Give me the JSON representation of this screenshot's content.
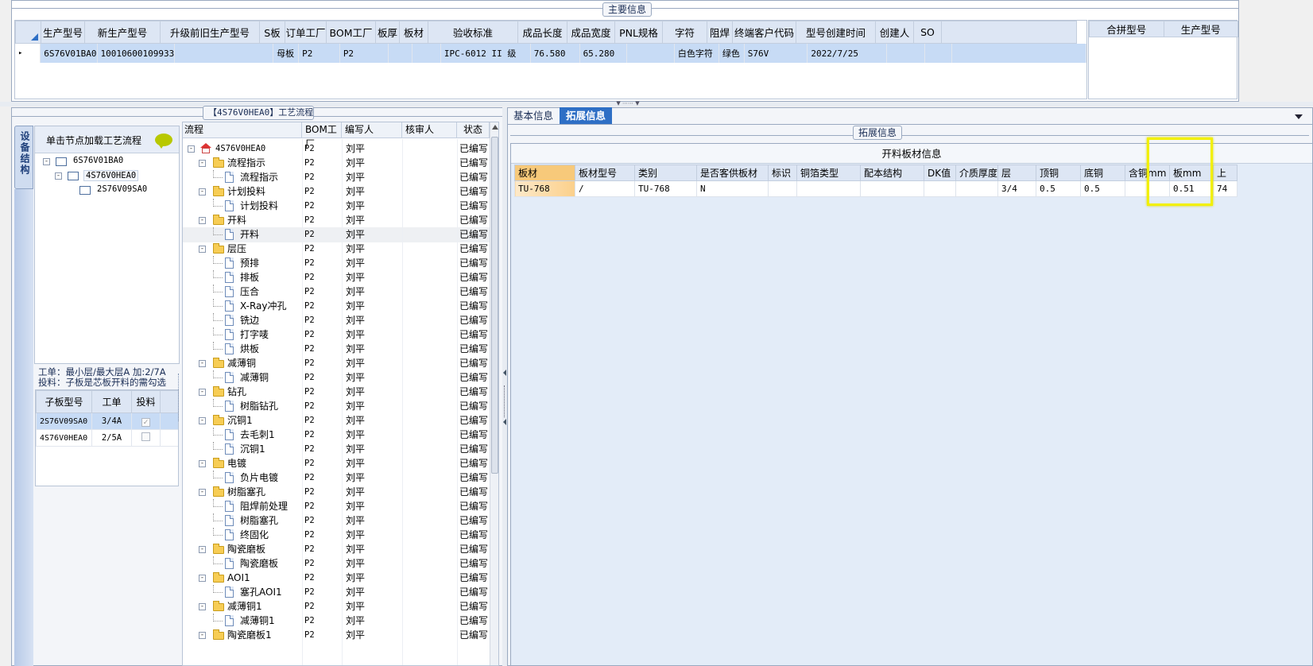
{
  "main_info": {
    "caption": "主要信息",
    "columns": [
      "生产型号",
      "新生产型号",
      "升级前旧生产型号",
      "S板",
      "订单工厂",
      "BOM工厂",
      "板厚",
      "板材",
      "验收标准",
      "成品长度",
      "成品宽度",
      "PNL规格",
      "字符",
      "阻焊",
      "终端客户代码",
      "型号创建时间",
      "创建人",
      "SO"
    ],
    "row": [
      "6S76V01BA0",
      "10010600109933",
      "",
      "母板",
      "P2",
      "P2",
      "",
      "",
      "IPC-6012 II 级",
      "76.580",
      "65.280",
      "",
      "白色字符",
      "绿色",
      "S76V",
      "2022/7/25",
      "",
      ""
    ],
    "row_marker": "▸",
    "side_columns": [
      "合拼型号",
      "生产型号"
    ]
  },
  "process": {
    "caption": "【4S76V0HEA0】工艺流程",
    "vertical_tab": "设备结构",
    "load_hint": "单击节点加载工艺流程",
    "structure_tree": [
      "6S76V01BA0",
      "4S76V0HEA0",
      "2S76V09SA0"
    ],
    "note_line1": "工单：最小层/最大层A 加:2/7A",
    "note_line2": "投料：子板是芯板开料的需勾选",
    "sub_columns": [
      "子板型号",
      "工单",
      "投料"
    ],
    "sub_rows": [
      {
        "model": "2S76V09SA0",
        "order": "3/4A",
        "checked": true
      },
      {
        "model": "4S76V0HEA0",
        "order": "2/5A",
        "checked": false
      }
    ],
    "flow_columns": [
      "流程",
      "BOM工厂",
      "编写人",
      "核审人",
      "状态"
    ],
    "root": "4S76V0HEA0",
    "factory": "P2",
    "writer": "刘平",
    "status": "已编写",
    "flow_rows": [
      {
        "level": 1,
        "name": "流程指示"
      },
      {
        "level": 2,
        "name": "流程指示"
      },
      {
        "level": 1,
        "name": "计划投料"
      },
      {
        "level": 2,
        "name": "计划投料"
      },
      {
        "level": 1,
        "name": "开料"
      },
      {
        "level": 2,
        "name": "开料"
      },
      {
        "level": 1,
        "name": "层压"
      },
      {
        "level": 2,
        "name": "预排"
      },
      {
        "level": 2,
        "name": "排板"
      },
      {
        "level": 2,
        "name": "压合"
      },
      {
        "level": 2,
        "name": "X-Ray冲孔"
      },
      {
        "level": 2,
        "name": "铣边"
      },
      {
        "level": 2,
        "name": "打字唛"
      },
      {
        "level": 2,
        "name": "烘板"
      },
      {
        "level": 1,
        "name": "减薄铜"
      },
      {
        "level": 2,
        "name": "减薄铜"
      },
      {
        "level": 1,
        "name": "钻孔"
      },
      {
        "level": 2,
        "name": "树脂钻孔"
      },
      {
        "level": 1,
        "name": "沉铜1"
      },
      {
        "level": 2,
        "name": "去毛刺1"
      },
      {
        "level": 2,
        "name": "沉铜1"
      },
      {
        "level": 1,
        "name": "电镀"
      },
      {
        "level": 2,
        "name": "负片电镀"
      },
      {
        "level": 1,
        "name": "树脂塞孔"
      },
      {
        "level": 2,
        "name": "阻焊前处理"
      },
      {
        "level": 2,
        "name": "树脂塞孔"
      },
      {
        "level": 2,
        "name": "终固化"
      },
      {
        "level": 1,
        "name": "陶瓷磨板"
      },
      {
        "level": 2,
        "name": "陶瓷磨板"
      },
      {
        "level": 1,
        "name": "AOI1"
      },
      {
        "level": 2,
        "name": "塞孔AOI1"
      },
      {
        "level": 1,
        "name": "减薄铜1"
      },
      {
        "level": 2,
        "name": "减薄铜1"
      },
      {
        "level": 1,
        "name": "陶瓷磨板1"
      }
    ]
  },
  "detail": {
    "tabs": [
      "基本信息",
      "拓展信息"
    ],
    "active_tab": 1,
    "caption": "拓展信息",
    "table_title": "开料板材信息",
    "columns": [
      "板材",
      "板材型号",
      "类别",
      "是否客供板材",
      "标识",
      "铜箔类型",
      "配本结构",
      "DK值",
      "介质厚度",
      "层",
      "顶铜",
      "底铜",
      "含铜mm",
      "板mm",
      "上"
    ],
    "row": [
      "TU-768",
      "/",
      "TU-768",
      "N",
      "",
      "",
      "",
      "",
      "",
      "3/4",
      "0.5",
      "0.5",
      "",
      "0.51",
      "74"
    ],
    "highlight_color": "#f2f000"
  },
  "colors": {
    "header_bg": "#dde6f4",
    "selection": "#c7dbf5",
    "accent": "#2e6fc5",
    "right_bg": "#e3ecf8"
  }
}
